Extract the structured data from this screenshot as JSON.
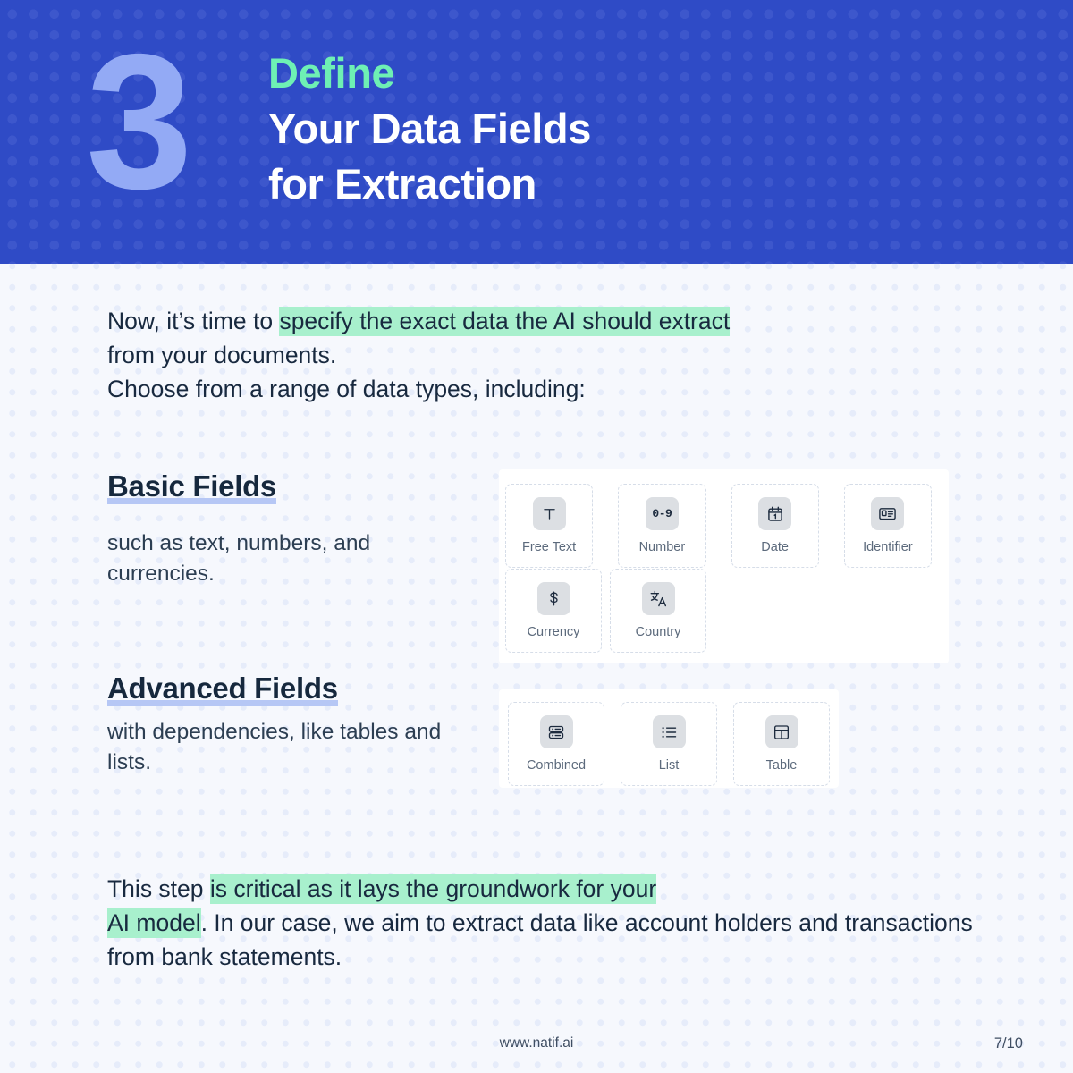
{
  "header": {
    "step_number": "3",
    "title_lines": [
      {
        "text": "Define",
        "accent": true
      },
      {
        "text": "Your Data Fields",
        "accent": false
      },
      {
        "text": "for Extraction",
        "accent": false
      }
    ],
    "bg_color": "#2f4bc6",
    "accent_color": "#6ef0b4",
    "number_color": "#93aaf5"
  },
  "intro": {
    "line1_pre": "Now, it’s time to ",
    "line1_highlight": "specify the exact data the AI should extract",
    "line2": "from your documents.",
    "line3": "Choose from a range of data types, including:",
    "highlight_color": "#a8f0cd"
  },
  "sections": {
    "basic": {
      "heading": "Basic Fields",
      "description": "such as text, numbers, and currencies.",
      "underline_color": "#b6c7f5"
    },
    "advanced": {
      "heading": "Advanced Fields",
      "description": "with dependencies, like tables and lists."
    }
  },
  "basic_fields": [
    {
      "label": "Free Text",
      "icon": "text-t-icon"
    },
    {
      "label": "Number",
      "icon": "number-0-9-icon",
      "glyph": "0-9"
    },
    {
      "label": "Date",
      "icon": "calendar-icon",
      "glyph": "1"
    },
    {
      "label": "Identifier",
      "icon": "id-card-icon"
    },
    {
      "label": "Currency",
      "icon": "dollar-icon"
    },
    {
      "label": "Country",
      "icon": "translate-icon"
    }
  ],
  "advanced_fields": [
    {
      "label": "Combined",
      "icon": "database-stack-icon"
    },
    {
      "label": "List",
      "icon": "bullet-list-icon"
    },
    {
      "label": "Table",
      "icon": "table-grid-icon"
    }
  ],
  "outro": {
    "pre": "This step ",
    "highlight1": "is critical as it lays the groundwork for your",
    "highlight2": "AI model",
    "post": ". In our case, we aim to extract data like account holders and transactions from bank statements."
  },
  "footer": {
    "url": "www.natif.ai",
    "page": "7/10"
  }
}
